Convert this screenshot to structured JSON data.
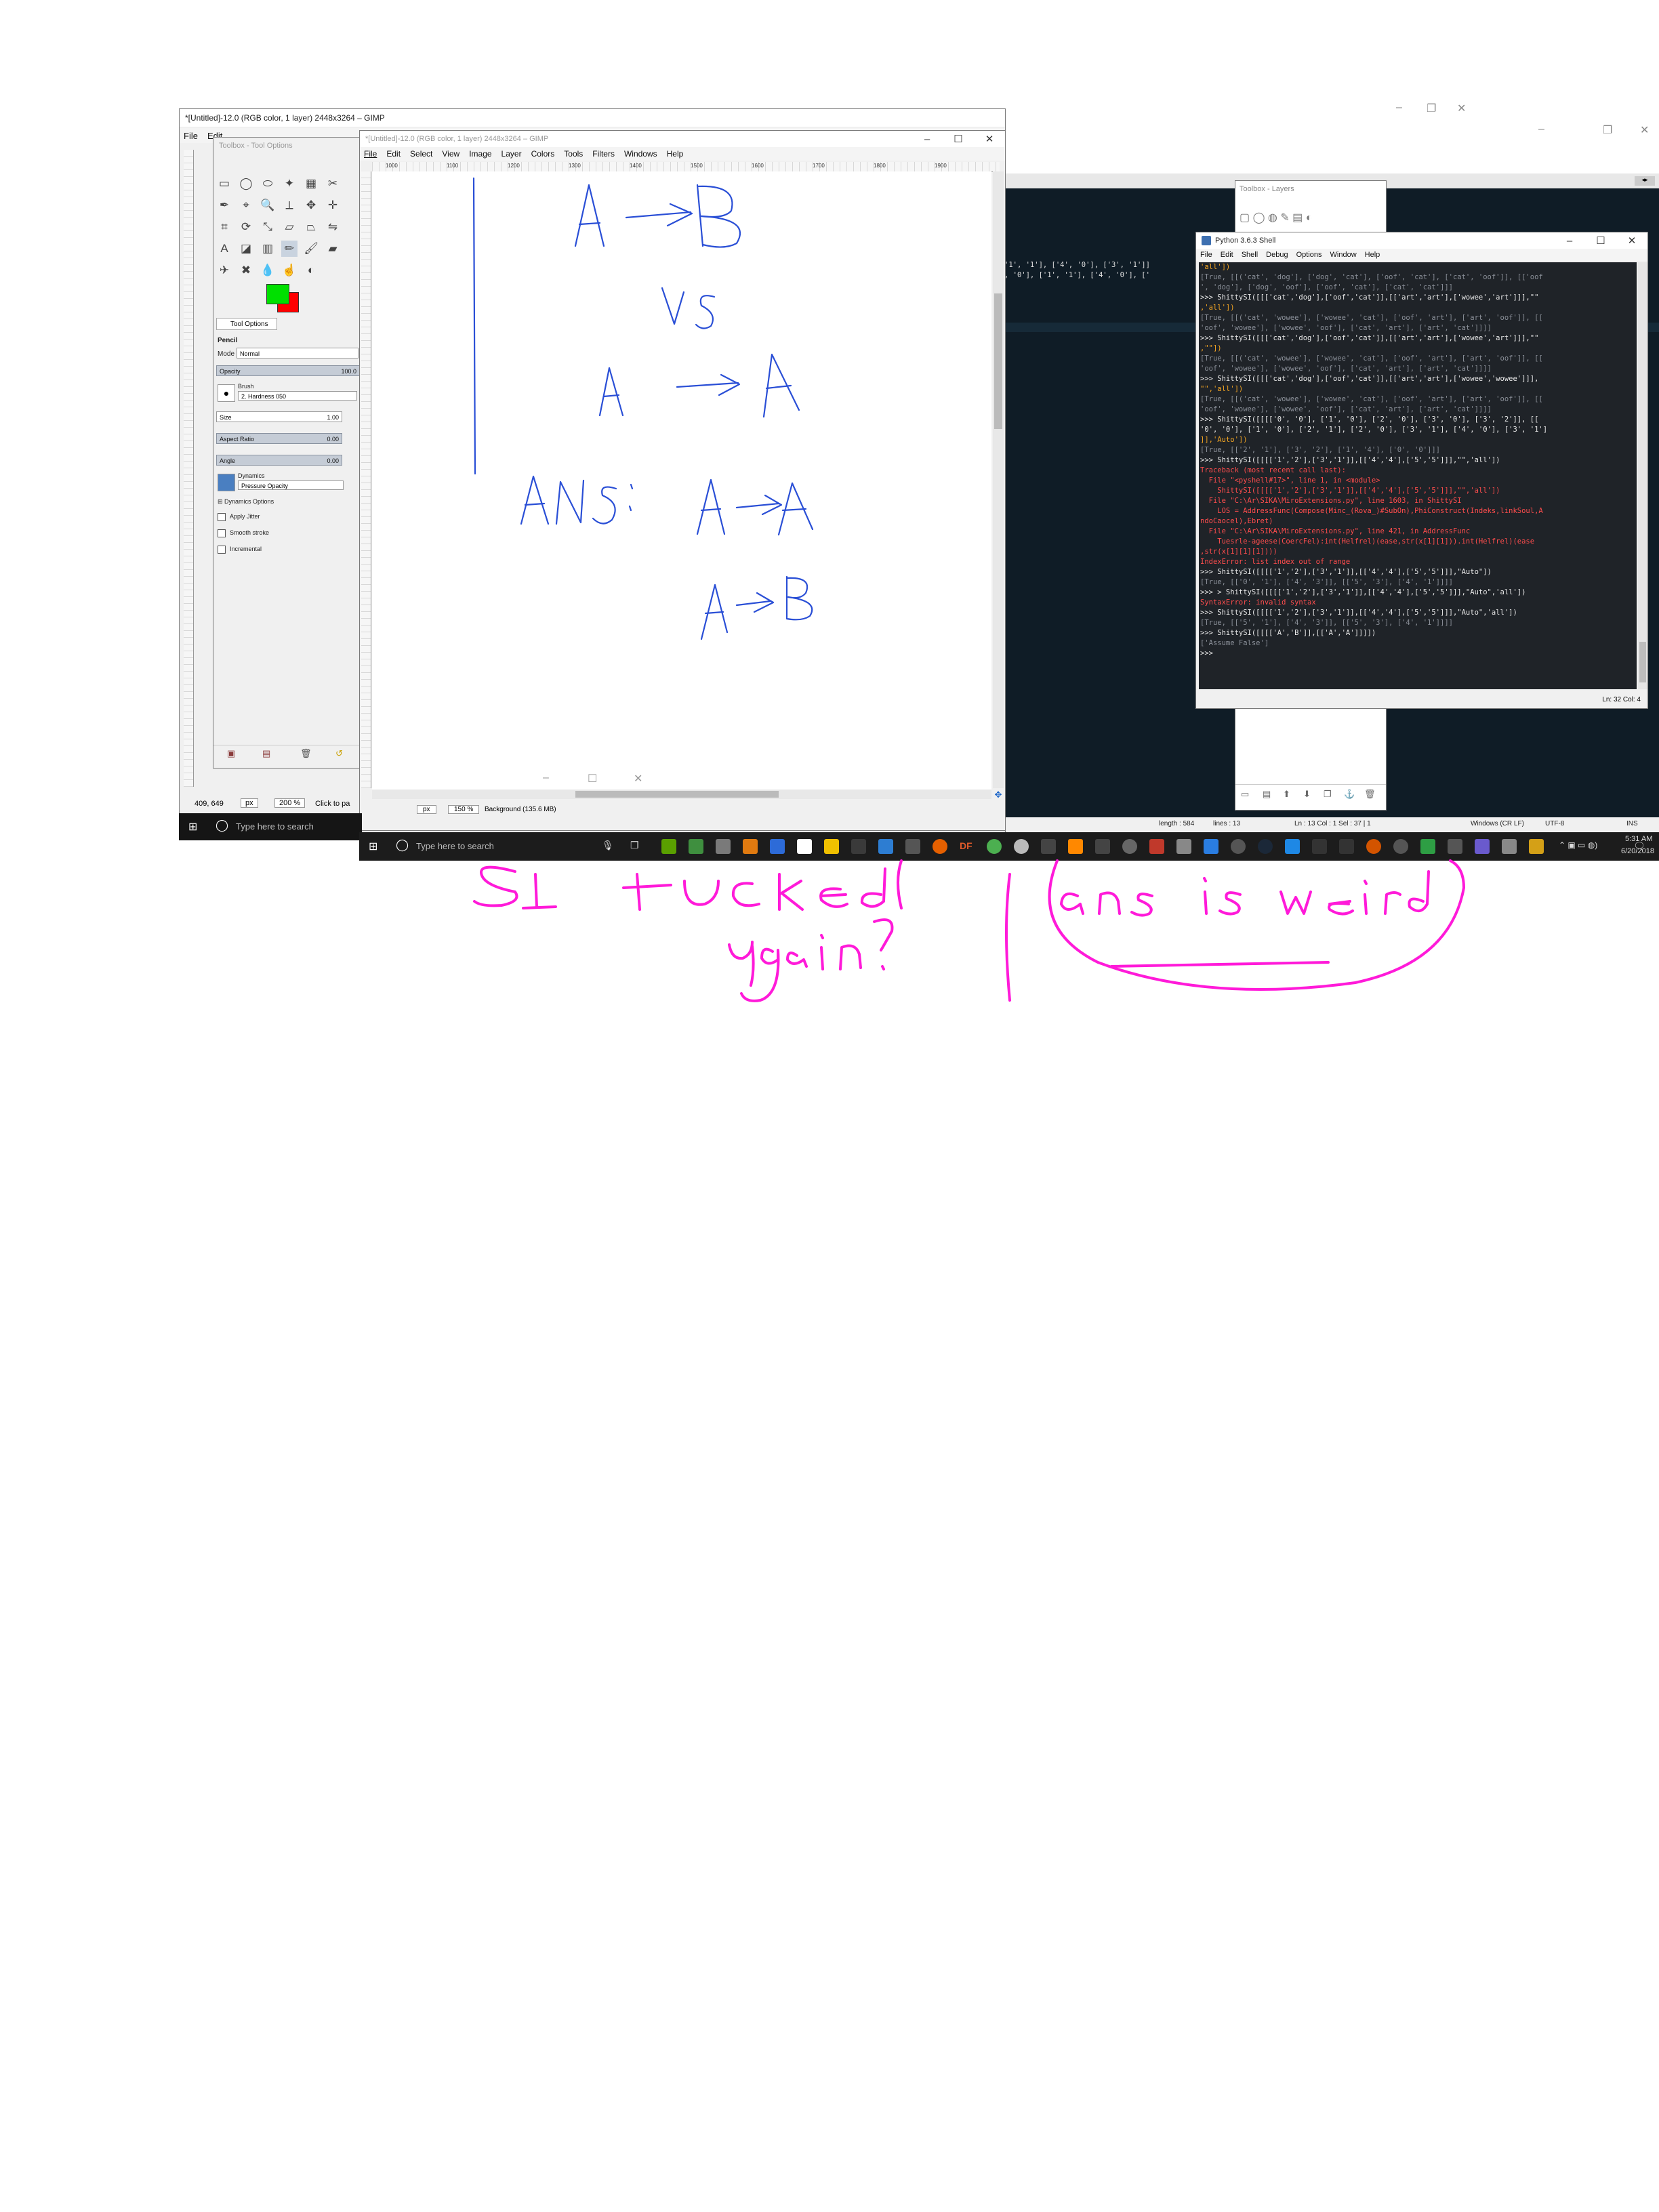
{
  "gimp_back": {
    "title": "*[Untitled]-12.0 (RGB color, 1 layer) 2448x3264 – GIMP",
    "menu_file": "File",
    "menu_edit": "Edit",
    "coords": "409, 649",
    "unit": "px",
    "zoom": "200 %",
    "status": "Click to pa"
  },
  "toolbox": {
    "title": "Toolbox - Tool Options",
    "tool_options_tab": "Tool Options",
    "tool_name": "Pencil",
    "mode_label": "Mode",
    "mode_value": "Normal",
    "opacity_label": "Opacity",
    "opacity_value": "100.0",
    "brush_label": "Brush",
    "brush_value": "2. Hardness 050",
    "size_label": "Size",
    "size_value": "1.00",
    "aspect_label": "Aspect Ratio",
    "aspect_value": "0.00",
    "angle_label": "Angle",
    "angle_value": "0.00",
    "dynamics_label": "Dynamics",
    "dynamics_value": "Pressure Opacity",
    "dynamics_options": "Dynamics Options",
    "apply_jitter": "Apply Jitter",
    "smooth_stroke": "Smooth stroke",
    "incremental": "Incremental",
    "fg_color": "#00e000",
    "bg_color": "#ff0000"
  },
  "gimp_front": {
    "title": "*[Untitled]-12.0 (RGB color, 1 layer) 2448x3264 – GIMP",
    "menus": [
      "File",
      "Edit",
      "Select",
      "View",
      "Image",
      "Layer",
      "Colors",
      "Tools",
      "Filters",
      "Windows",
      "Help"
    ],
    "unit": "px",
    "zoom": "150 %",
    "status": "Background (135.6 MB)",
    "ruler_ticks": [
      "1000",
      "1100",
      "1200",
      "1300",
      "1400",
      "1500",
      "1600",
      "1700",
      "1800",
      "1900"
    ]
  },
  "layers_panel": {
    "title": "Toolbox - Layers"
  },
  "python_shell": {
    "title": "Python 3.6.3 Shell",
    "menus": [
      "File",
      "Edit",
      "Shell",
      "Debug",
      "Options",
      "Window",
      "Help"
    ],
    "status": "Ln: 32   Col: 4",
    "lines": [
      {
        "text": "'all'])",
        "color": "#f5a623"
      },
      {
        "text": "[True, [[('cat', 'dog'], ['dog', 'cat'], ['oof', 'cat'], ['cat', 'oof']], [['oof",
        "color": "#8a8f98"
      },
      {
        "text": "', 'dog'], ['dog', 'oof'], ['oof', 'cat'], ['cat', 'cat']]]",
        "color": "#8a8f98"
      },
      {
        "text": ">>> ShittySI([[['cat','dog'],['oof','cat']],[['art','art'],['wowee','art']]],\"\"",
        "color": "#e8e8e8"
      },
      {
        "text": ",'all'])",
        "color": "#f5a623"
      },
      {
        "text": "[True, [[('cat', 'wowee'], ['wowee', 'cat'], ['oof', 'art'], ['art', 'oof']], [[",
        "color": "#8a8f98"
      },
      {
        "text": "'oof', 'wowee'], ['wowee', 'oof'], ['cat', 'art'], ['art', 'cat']]]]",
        "color": "#8a8f98"
      },
      {
        "text": ">>> ShittySI([[['cat','dog'],['oof','cat']],[['art','art'],['wowee','art']]],\"\"",
        "color": "#e8e8e8"
      },
      {
        "text": ",\"\"])",
        "color": "#f5a623"
      },
      {
        "text": "[True, [[('cat', 'wowee'], ['wowee', 'cat'], ['oof', 'art'], ['art', 'oof']], [[",
        "color": "#8a8f98"
      },
      {
        "text": "'oof', 'wowee'], ['wowee', 'oof'], ['cat', 'art'], ['art', 'cat']]]]",
        "color": "#8a8f98"
      },
      {
        "text": ">>> ShittySI([[['cat','dog'],['oof','cat']],[['art','art'],['wowee','wowee']]],",
        "color": "#e8e8e8"
      },
      {
        "text": "\"\",'all'])",
        "color": "#f5a623"
      },
      {
        "text": "[True, [[('cat', 'wowee'], ['wowee', 'cat'], ['oof', 'art'], ['art', 'oof']], [[",
        "color": "#8a8f98"
      },
      {
        "text": "'oof', 'wowee'], ['wowee', 'oof'], ['cat', 'art'], ['art', 'cat']]]]",
        "color": "#8a8f98"
      },
      {
        "text": ">>> ShittySI([[[['0', '0'], ['1', '0'], ['2', '0'], ['3', '0'], ['3', '2']], [[",
        "color": "#e8e8e8"
      },
      {
        "text": "'0', '0'], ['1', '0'], ['2', '1'], ['2', '0'], ['3', '1'], ['4', '0'], ['3', '1']",
        "color": "#e8e8e8"
      },
      {
        "text": "]],'Auto'])",
        "color": "#f5a623"
      },
      {
        "text": "[True, [['2', '1'], ['3', '2'], ['1', '4'], ['0', '0']]]",
        "color": "#8a8f98"
      },
      {
        "text": ">>> ShittySI([[[['1','2'],['3','1']],[['4','4'],['5','5']]],\"\",'all'])",
        "color": "#e8e8e8"
      },
      {
        "text": "Traceback (most recent call last):",
        "color": "#ff4d4d"
      },
      {
        "text": "  File \"<pyshell#17>\", line 1, in <module>",
        "color": "#ff4d4d"
      },
      {
        "text": "    ShittySI([[[['1','2'],['3','1']],[['4','4'],['5','5']]],\"\",'all'])",
        "color": "#ff4d4d"
      },
      {
        "text": "  File \"C:\\Ar\\SIKA\\MiroExtensions.py\", line 1603, in ShittySI",
        "color": "#ff4d4d"
      },
      {
        "text": "    LOS = AddressFunc(Compose(Minc_(Rova_)#SubOn),PhiConstruct(Indeks,linkSoul,A",
        "color": "#ff4d4d"
      },
      {
        "text": "ndoCaocel),Ebret)",
        "color": "#ff4d4d"
      },
      {
        "text": "  File \"C:\\Ar\\SIKA\\MiroExtensions.py\", line 421, in AddressFunc",
        "color": "#ff4d4d"
      },
      {
        "text": "    Tuesrle-ageese(CoercFel):int(Helfrel)(ease,str(x[1][1])).int(Helfrel)(ease",
        "color": "#ff4d4d"
      },
      {
        "text": ",str(x[1][1][1])))",
        "color": "#ff4d4d"
      },
      {
        "text": "IndexError: list index out of range",
        "color": "#ff4d4d"
      },
      {
        "text": ">>> ShittySI([[[['1','2'],['3','1']],[['4','4'],['5','5']]],\"Auto\"])",
        "color": "#e8e8e8"
      },
      {
        "text": "[True, [['0', '1'], ['4', '3']], [['5', '3'], ['4', '1']]]]",
        "color": "#8a8f98"
      },
      {
        "text": ">>> > ShittySI([[[['1','2'],['3','1']],[['4','4'],['5','5']]],\"Auto\",'all'])",
        "color": "#e8e8e8"
      },
      {
        "text": "SyntaxError: invalid syntax",
        "color": "#ff4d4d"
      },
      {
        "text": ">>> ShittySI([[[['1','2'],['3','1']],[['4','4'],['5','5']]],\"Auto\",'all'])",
        "color": "#e8e8e8"
      },
      {
        "text": "[True, [['5', '1'], ['4', '3']], [['5', '3'], ['4', '1']]]]",
        "color": "#8a8f98"
      },
      {
        "text": ">>> ShittySI([[[['A','B']],[['A','A']]]])",
        "color": "#e8e8e8"
      },
      {
        "text": "['Assume False']",
        "color": "#8a8f98"
      },
      {
        "text": ">>> ",
        "color": "#e8e8e8"
      }
    ]
  },
  "editor_bg": {
    "code_line1": "'1', '1'], ['4', '0'], ['3', '1']]",
    "code_line2": ", '0'], ['1', '1'], ['4', '0'], ['",
    "status_length": "length : 584",
    "status_lines": "lines : 13",
    "status_pos": "Ln : 13   Col : 1   Sel : 37 | 1",
    "status_eol": "Windows (CR LF)",
    "status_enc": "UTF-8",
    "status_ins": "INS"
  },
  "taskbar_back": {
    "search_placeholder": "Type here to search"
  },
  "taskbar_front": {
    "search_placeholder": "Type here to search",
    "time": "5:31 AM",
    "date": "6/20/2018",
    "df_label": "DF"
  },
  "annotation_colors": {
    "blue_ink": "#2a4fd6",
    "magenta_ink": "#ff1ad9",
    "green_stroke": "#22d422"
  }
}
